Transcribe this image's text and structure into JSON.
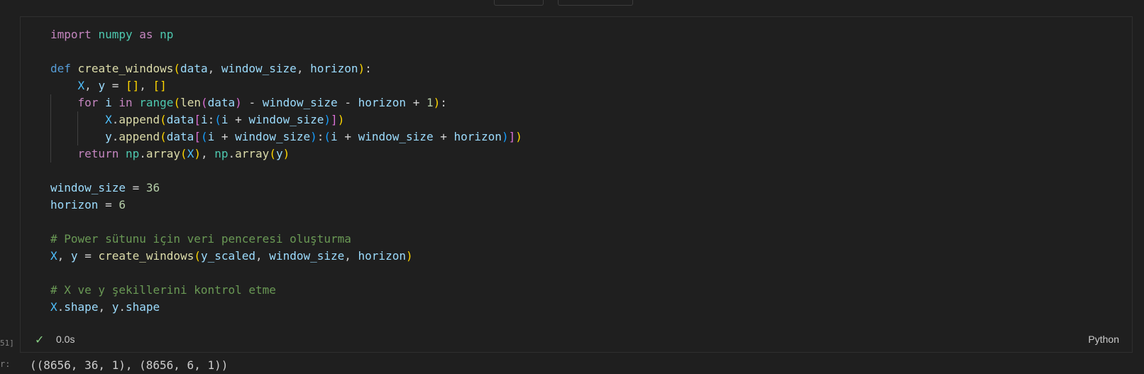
{
  "cell": {
    "execution_count": "51]",
    "status_time": "0.0s",
    "language": "Python",
    "output_label": "r:",
    "output_text": "((8656, 36, 1), (8656, 6, 1))"
  },
  "code": {
    "import_kw": "import",
    "import_mod": "numpy",
    "as_kw": "as",
    "alias": "np",
    "def_kw": "def",
    "fn_name": "create_windows",
    "param1": "data",
    "param2": "window_size",
    "param3": "horizon",
    "X": "X",
    "y": "y",
    "for_kw": "for",
    "i": "i",
    "in_kw": "in",
    "range": "range",
    "len": "len",
    "one": "1",
    "append": "append",
    "return_kw": "return",
    "array": "array",
    "window_size_val": "36",
    "horizon_val": "6",
    "comment1": "# Power sütunu için veri penceresi oluşturma",
    "y_scaled": "y_scaled",
    "comment2": "# X ve y şekillerini kontrol etme",
    "shape": "shape"
  },
  "colors": {
    "background": "#1f1f1f",
    "keyword": "#c586c0",
    "function": "#dcdcaa",
    "variable": "#9cdcfe",
    "comment": "#6a9955",
    "number": "#b5cea8",
    "success": "#89d185"
  }
}
